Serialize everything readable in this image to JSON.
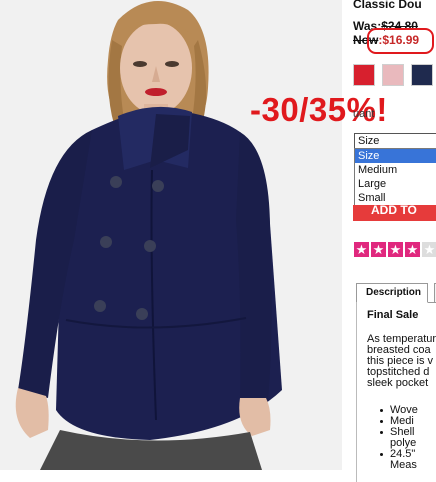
{
  "product": {
    "title": "Classic Dou",
    "was_label": "Was:",
    "was_price": "$24.80",
    "now_label": "Now",
    "now_price": ":$16.99",
    "image_alt": "Navy double-breasted coat on model"
  },
  "swatches": [
    {
      "name": "red",
      "color": "#d7202e"
    },
    {
      "name": "pink",
      "color": "#e9b9bd"
    },
    {
      "name": "navy",
      "color": "#1f2a4e"
    }
  ],
  "promo_text": "-30/35%!",
  "quantity_label": "uant",
  "size_select": {
    "value": "Size",
    "options": [
      "Size",
      "Medium",
      "Large",
      "Small"
    ],
    "selected_index": 0
  },
  "add_button_label": "ADD TO",
  "rating": {
    "filled": 4,
    "total": 5,
    "color": "#e0287e"
  },
  "tabs": [
    "Description"
  ],
  "description": {
    "heading": "Final Sale",
    "lines": [
      "As temperatur",
      "breasted coa",
      "this piece is v",
      "topstitched d",
      "sleek pocket"
    ],
    "bullets": [
      {
        "text": "Wove"
      },
      {
        "text": "Medi"
      },
      {
        "text": "Shell",
        "cont": "polye"
      },
      {
        "text": "24.5\"",
        "cont": "Meas"
      }
    ]
  },
  "colors": {
    "accent_red": "#e0191d",
    "coat_navy": "#1c2050",
    "star_pink": "#e0287e"
  }
}
